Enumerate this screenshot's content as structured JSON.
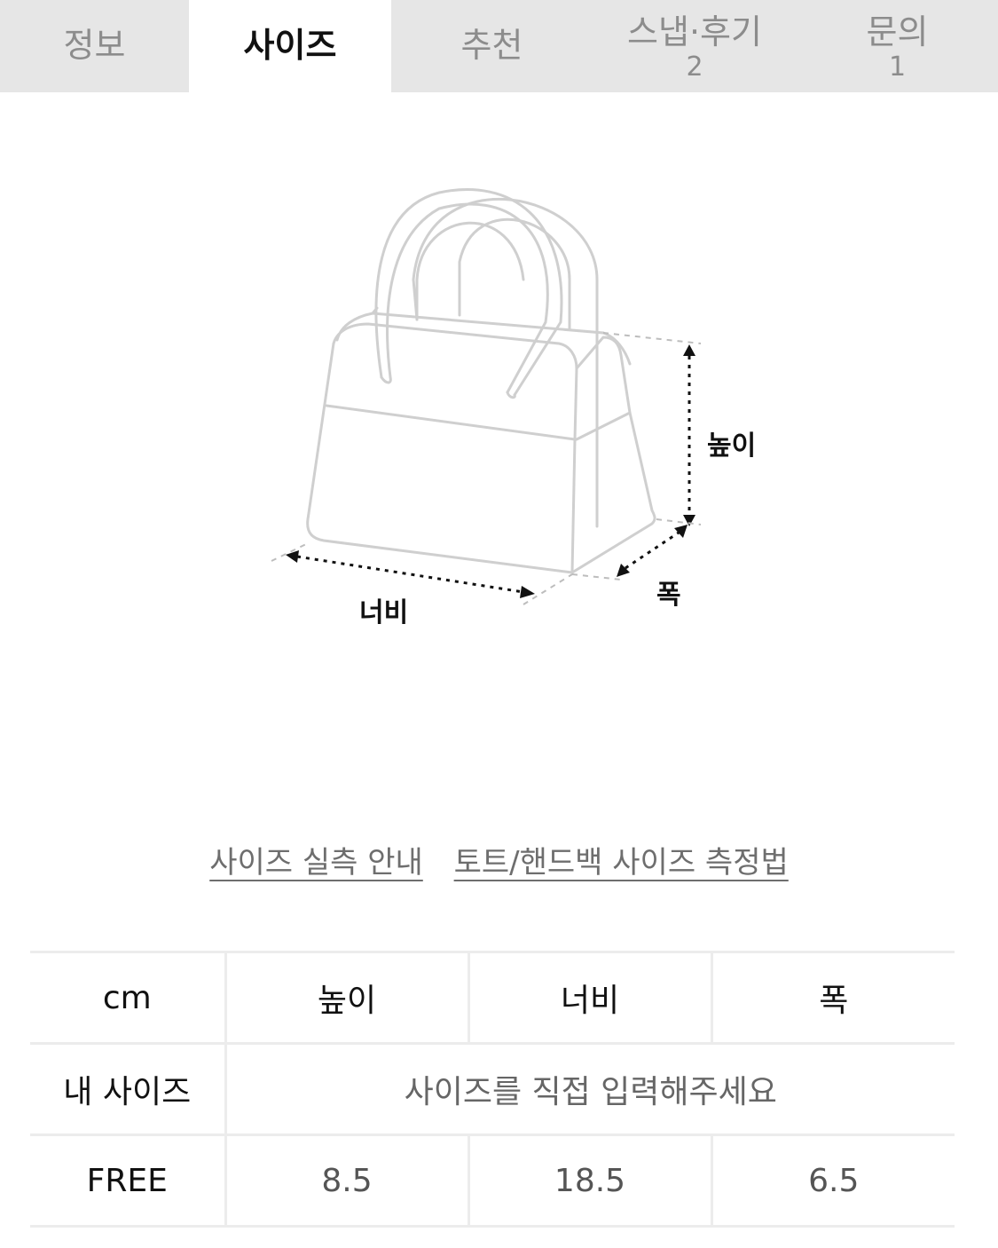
{
  "tabs": [
    {
      "label": "정보",
      "count": ""
    },
    {
      "label": "사이즈",
      "count": ""
    },
    {
      "label": "추천",
      "count": ""
    },
    {
      "label": "스냅·후기",
      "count": "2"
    },
    {
      "label": "문의",
      "count": "1"
    }
  ],
  "active_tab": "사이즈",
  "diagram": {
    "height_label": "높이",
    "width_label": "너비",
    "depth_label": "폭"
  },
  "links": {
    "size_guide": "사이즈 실측 안내",
    "measure_method": "토트/핸드백 사이즈 측정법"
  },
  "table": {
    "headers": [
      "cm",
      "높이",
      "너비",
      "폭"
    ],
    "my_size_label": "내 사이즈",
    "my_size_hint": "사이즈를 직접 입력해주세요",
    "rows": [
      {
        "size": "FREE",
        "values": [
          "8.5",
          "18.5",
          "6.5"
        ]
      }
    ]
  }
}
